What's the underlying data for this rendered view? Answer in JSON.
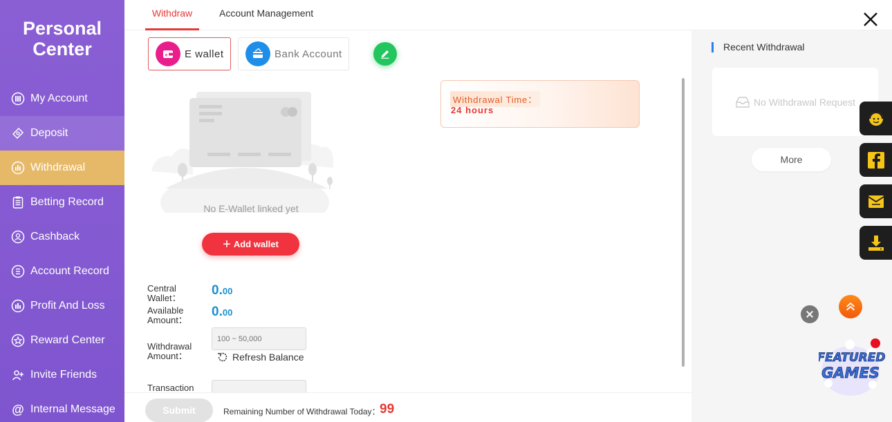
{
  "sidebar": {
    "title_line1": "Personal",
    "title_line2": "Center",
    "items": [
      {
        "label": "My Account",
        "icon": "account-icon"
      },
      {
        "label": "Deposit",
        "icon": "deposit-icon"
      },
      {
        "label": "Withdrawal",
        "icon": "withdrawal-icon"
      },
      {
        "label": "Betting Record",
        "icon": "betting-record-icon"
      },
      {
        "label": "Cashback",
        "icon": "cashback-icon"
      },
      {
        "label": "Account Record",
        "icon": "account-record-icon"
      },
      {
        "label": "Profit And Loss",
        "icon": "profit-loss-icon"
      },
      {
        "label": "Reward Center",
        "icon": "reward-icon"
      },
      {
        "label": "Invite Friends",
        "icon": "invite-icon"
      },
      {
        "label": "Internal Message",
        "icon": "message-icon"
      }
    ],
    "active": "Withdrawal"
  },
  "tabs": [
    {
      "label": "Withdraw",
      "active": true
    },
    {
      "label": "Account Management",
      "active": false
    }
  ],
  "methods": [
    {
      "label": "E wallet",
      "icon": "e-wallet-icon",
      "active": true
    },
    {
      "label": "Bank Account",
      "icon": "bank-card-icon",
      "active": false
    }
  ],
  "withdrawal_time": {
    "label": "Withdrawal Time：",
    "value": "24 hours"
  },
  "empty_wallet": {
    "text": "No E-Wallet linked yet",
    "add_label": "Add wallet"
  },
  "form": {
    "central_wallet_label": "Central Wallet：",
    "central_wallet_int": "0.",
    "central_wallet_dec": "00",
    "available_label": "Available Amount：",
    "available_int": "0.",
    "available_dec": "00",
    "withdrawal_amount_label": "Withdrawal Amount：",
    "amount_placeholder": "100 ~ 50,000",
    "refresh_label": "Refresh Balance",
    "transaction_label": "Transaction"
  },
  "bottom": {
    "submit_label": "Submit",
    "remaining_label": "Remaining Number of Withdrawal Today：",
    "remaining_value": "99"
  },
  "right_panel": {
    "title": "Recent Withdrawal",
    "empty_text": "No Withdrawal Request",
    "more_label": "More"
  },
  "floating": [
    {
      "icon": "customer-service-icon"
    },
    {
      "icon": "facebook-icon"
    },
    {
      "icon": "mail-icon"
    },
    {
      "icon": "download-icon"
    }
  ],
  "featured": {
    "line1": "FEATURED",
    "line2": "GAMES"
  },
  "colors": {
    "sidebar": "#8459d1",
    "active_nav": "#e6b969",
    "accent_red": "#e53935",
    "amount_blue": "#1a8fd0",
    "edit_green": "#22c55e"
  }
}
